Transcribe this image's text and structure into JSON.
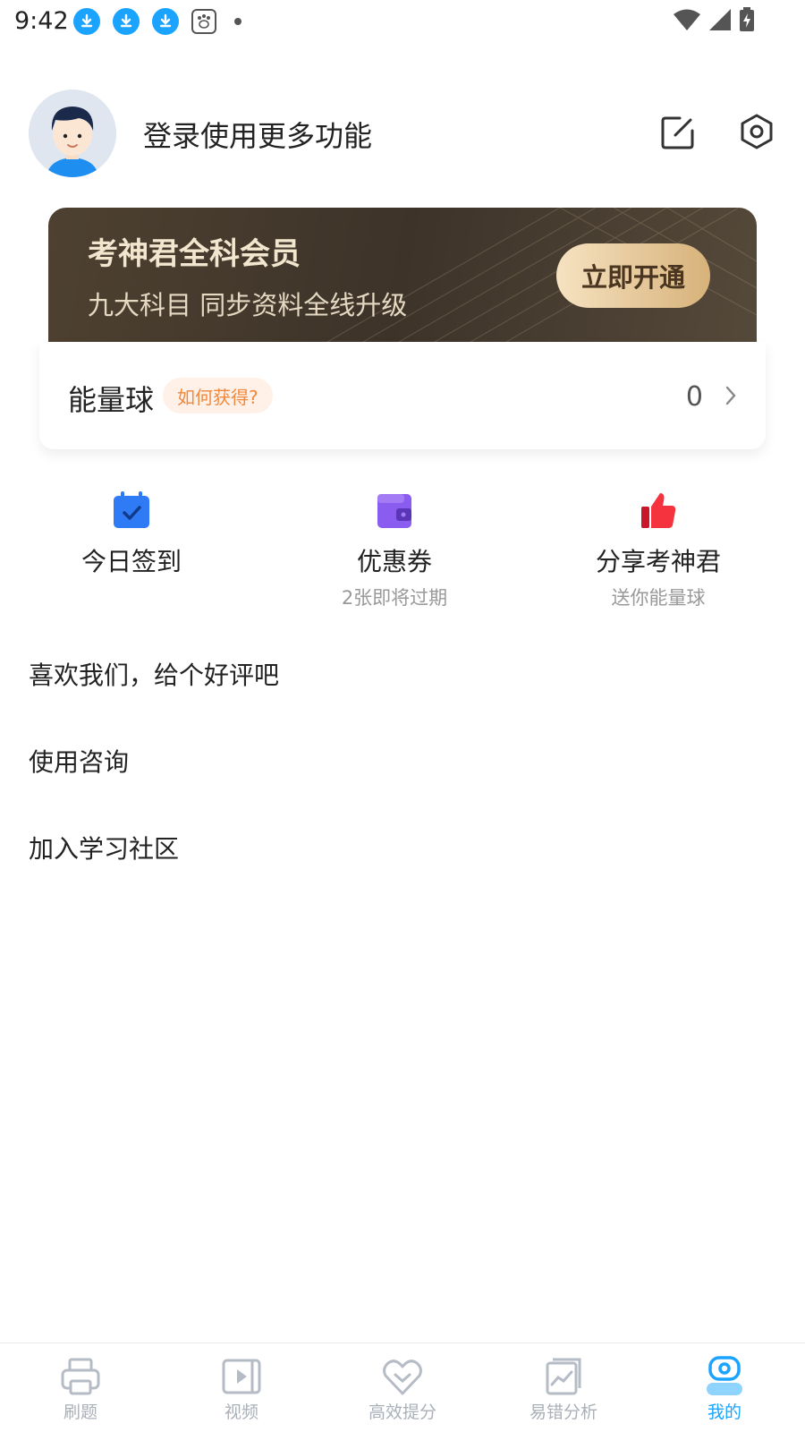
{
  "status_bar": {
    "time": "9:42",
    "left_icons": [
      "download-icon",
      "download-icon",
      "download-icon",
      "baidu-icon",
      "dot-icon"
    ],
    "right_icons": [
      "wifi-icon",
      "signal-icon",
      "battery-charging-icon"
    ]
  },
  "header": {
    "login_text": "登录使用更多功能",
    "icons": [
      "edit-icon",
      "settings-icon"
    ]
  },
  "banner": {
    "title": "考神君全科会员",
    "subtitle": "九大科目 同步资料全线升级",
    "button_label": "立即开通",
    "colors": {
      "background": "#3d3329",
      "button": "#e6c693",
      "title": "#f3e6cf"
    }
  },
  "energy": {
    "label": "能量球",
    "badge": "如何获得?",
    "value": "0"
  },
  "quick_actions": [
    {
      "label": "今日签到",
      "sub": "",
      "icon": "calendar-check-icon",
      "color": "#2f7bf6"
    },
    {
      "label": "优惠券",
      "sub": "2张即将过期",
      "icon": "wallet-icon",
      "color": "#8a5cf0"
    },
    {
      "label": "分享考神君",
      "sub": "送你能量球",
      "icon": "thumbs-up-icon",
      "color": "#f5333f"
    }
  ],
  "list": [
    {
      "label": "喜欢我们，给个好评吧"
    },
    {
      "label": "使用咨询"
    },
    {
      "label": "加入学习社区"
    }
  ],
  "bottom_nav": [
    {
      "label": "刷题",
      "icon": "printer-icon",
      "active": false
    },
    {
      "label": "视频",
      "icon": "video-icon",
      "active": false
    },
    {
      "label": "高效提分",
      "icon": "heart-check-icon",
      "active": false
    },
    {
      "label": "易错分析",
      "icon": "chart-icon",
      "active": false
    },
    {
      "label": "我的",
      "icon": "profile-icon",
      "active": true
    }
  ],
  "accent_color": "#1aa3ff"
}
